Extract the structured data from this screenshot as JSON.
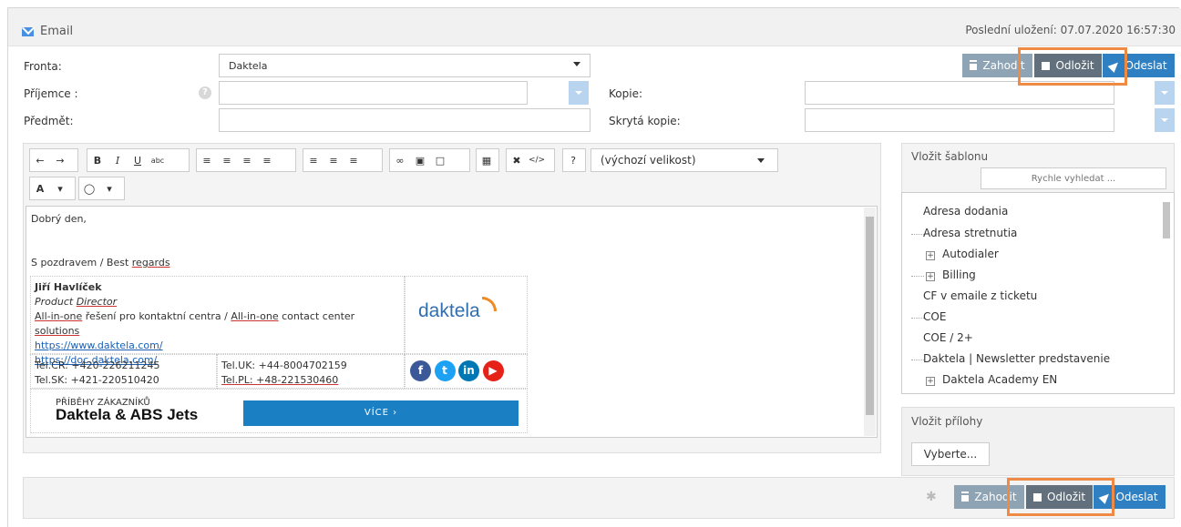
{
  "header": {
    "title": "Email",
    "saved": "Poslední uložení: 07.07.2020 16:57:30"
  },
  "form": {
    "fronta_label": "Fronta:",
    "fronta_value": "Daktela",
    "prijemce_label": "Příjemce :",
    "help_icon": "?",
    "predmet_label": "Předmět:",
    "kopie_label": "Kopie:",
    "skryta_label": "Skrytá kopie:"
  },
  "actions": {
    "discard": "Zahodit",
    "postpone": "Odložit",
    "send": "Odeslat"
  },
  "toolbar": {
    "bold": "B",
    "italic": "I",
    "underline": "U",
    "strike": "abc",
    "help": "?",
    "size_value": "(výchozí velikost)",
    "font_color": "A"
  },
  "editor": {
    "greeting": "Dobrý den,",
    "closing_a": "S pozdravem / Best ",
    "closing_b": "regards",
    "sig": {
      "name": "Jiří Havlíček",
      "title_a": "Product ",
      "title_b": "Director",
      "line_a": "All-in-one",
      "line_b": " řešení pro kontaktní centra / ",
      "line_c": "All-in-one",
      "line_d": " contact center ",
      "line_e": "solutions",
      "link1": "https://www.daktela.com/",
      "link2": "https://doc.daktela.com/",
      "tel_cr": "Tel.CR: +420-226211245",
      "tel_sk": "Tel.SK: +421-220510420",
      "tel_uk": "Tel.UK: +44-8004702159",
      "tel_pl": "Tel.PL:  +48-221530460",
      "logo": "daktela",
      "banner_top": "PŘÍBĚHY ZÁKAZNÍKŮ",
      "banner_main": "Daktela & ABS Jets",
      "banner_btn": "VÍCE ›"
    }
  },
  "templates": {
    "title": "Vložit šablonu",
    "search_placeholder": "Rychle vyhledat ...",
    "items": [
      "Adresa dodania",
      "Adresa stretnutia",
      "Autodialer",
      "Billing",
      "CF v emaile z ticketu",
      "COE",
      "COE / 2+",
      "Daktela | Newsletter predstavenie",
      "Daktela Academy EN"
    ]
  },
  "attachments": {
    "title": "Vložit přílohy",
    "button": "Vyberte..."
  },
  "colors": {
    "accent": "#2f80c3",
    "highlight": "#ef8a45"
  }
}
